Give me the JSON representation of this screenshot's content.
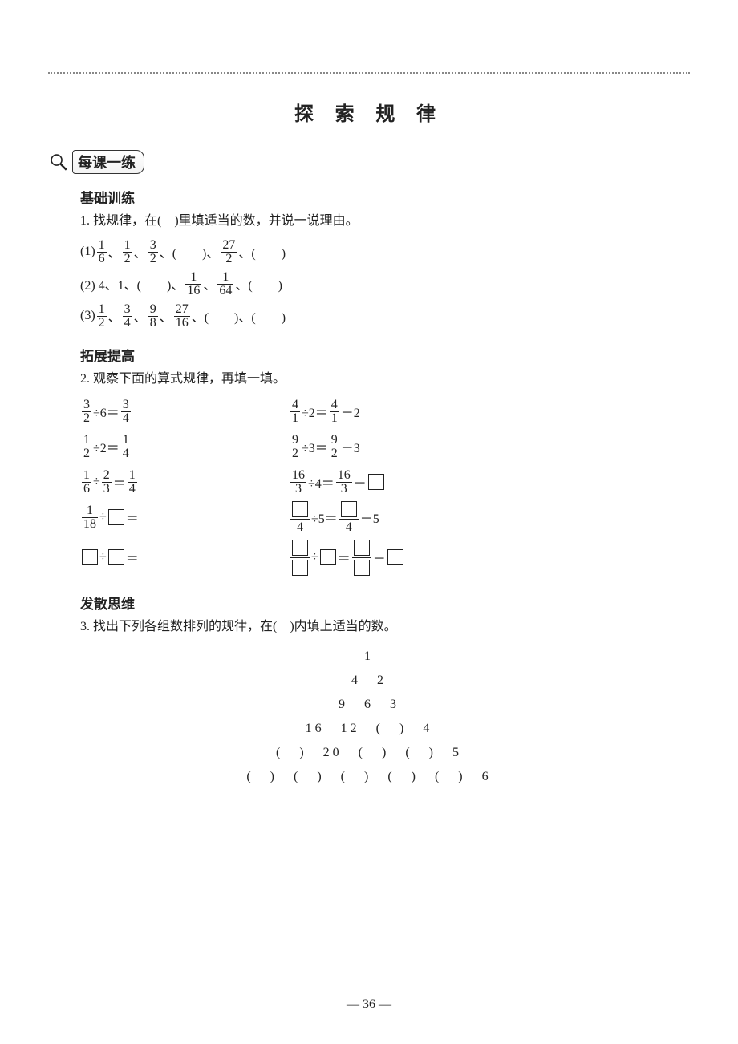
{
  "title": "探 索 规 律",
  "practice_label": "每课一练",
  "sectionA": {
    "head": "基础训练",
    "q1": "1. 找规律，在(　)里填适当的数，并说一说理由。",
    "q1_1_prefix": "(1) ",
    "q1_1_f1n": "1",
    "q1_1_f1d": "6",
    "q1_1_f2n": "1",
    "q1_1_f2d": "2",
    "q1_1_f3n": "3",
    "q1_1_f3d": "2",
    "q1_1_mid": "、(　　)、",
    "q1_1_f4n": "27",
    "q1_1_f4d": "2",
    "q1_1_tail": "、(　　)",
    "q1_2_prefix": "(2) 4、1、(　　)、",
    "q1_2_f1n": "1",
    "q1_2_f1d": "16",
    "q1_2_sep": "、",
    "q1_2_f2n": "1",
    "q1_2_f2d": "64",
    "q1_2_tail": "、(　　)",
    "q1_3_prefix": "(3) ",
    "q1_3_f1n": "1",
    "q1_3_f1d": "2",
    "q1_3_f2n": "3",
    "q1_3_f2d": "4",
    "q1_3_f3n": "9",
    "q1_3_f3d": "8",
    "q1_3_f4n": "27",
    "q1_3_f4d": "16",
    "q1_3_tail": "、(　　)、(　　)"
  },
  "sectionB": {
    "head": "拓展提高",
    "q2": "2. 观察下面的算式规律，再填一填。",
    "r1L_an": "3",
    "r1L_ad": "2",
    "r1L_div": "÷6＝",
    "r1L_bn": "3",
    "r1L_bd": "4",
    "r1R_an": "4",
    "r1R_ad": "1",
    "r1R_div": "÷2＝",
    "r1R_bn": "4",
    "r1R_bd": "1",
    "r1R_tail": "－2",
    "r2L_an": "1",
    "r2L_ad": "2",
    "r2L_div": "÷2＝",
    "r2L_bn": "1",
    "r2L_bd": "4",
    "r2R_an": "9",
    "r2R_ad": "2",
    "r2R_div": "÷3＝",
    "r2R_bn": "9",
    "r2R_bd": "2",
    "r2R_tail": "－3",
    "r3L_an": "1",
    "r3L_ad": "6",
    "r3L_div": "÷",
    "r3L_cn": "2",
    "r3L_cd": "3",
    "r3L_eq": "＝",
    "r3L_bn": "1",
    "r3L_bd": "4",
    "r3R_an": "16",
    "r3R_ad": "3",
    "r3R_div": "÷4＝",
    "r3R_bn": "16",
    "r3R_bd": "3",
    "r3R_tail": "－",
    "r4L_an": "1",
    "r4L_ad": "18",
    "r4L_div": "÷",
    "r4L_eq": "＝",
    "r4R_d": "4",
    "r4R_div": "÷5＝",
    "r4R_d2": "4",
    "r4R_tail": "－5",
    "r5L_div": "÷",
    "r5L_eq": "＝",
    "r5R_div": "÷",
    "r5R_eq": "＝",
    "r5R_minus": "－"
  },
  "sectionC": {
    "head": "发散思维",
    "q3": "3. 找出下列各组数排列的规律，在(　)内填上适当的数。",
    "pyr": [
      "1",
      "4　2",
      "9　6　3",
      "16　12　(　)　4",
      "(　)　20　(　)　(　)　5",
      "(　)　(　)　(　)　(　)　(　)　6"
    ]
  },
  "pagenum": "— 36 —"
}
